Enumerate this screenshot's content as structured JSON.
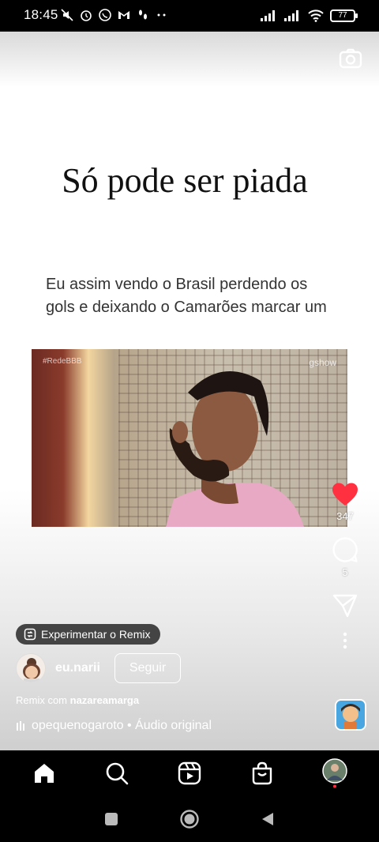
{
  "status_bar": {
    "time": "18:45",
    "battery": "77"
  },
  "post": {
    "headline": "Só pode ser piada",
    "tweet_text": "Eu assim vendo o Brasil perdendo os gols e deixando o Camarões marcar um",
    "video_tag_left": "#RedeBBB",
    "video_tag_right": "gshow"
  },
  "actions": {
    "likes": "347",
    "comments": "5"
  },
  "remix_pill_label": "Experimentar o Remix",
  "author": {
    "username": "eu.narii",
    "follow_label": "Seguir"
  },
  "remix_credit": {
    "prefix": "Remix com",
    "user": "nazareamarga"
  },
  "audio": {
    "text": "opequenogaroto • Áudio original"
  },
  "icons": {
    "like": "heart-icon",
    "comment": "comment-icon",
    "share": "paper-plane-icon",
    "more": "more-vertical-icon",
    "camera": "camera-icon",
    "home": "home-icon",
    "search": "search-icon",
    "reels": "reels-icon",
    "shop": "shop-icon"
  },
  "colors": {
    "like_red": "#ff3040",
    "bar_black": "#000000"
  }
}
